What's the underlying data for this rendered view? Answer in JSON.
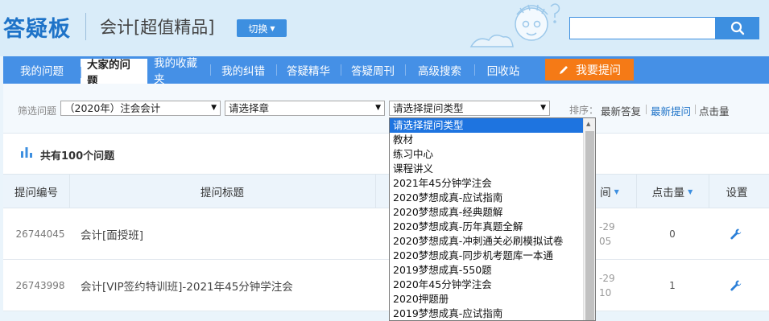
{
  "header": {
    "logo": "答疑板",
    "subtitle": "会计[超值精品]",
    "switch_label": "切换",
    "search_placeholder": ""
  },
  "nav": {
    "items": [
      "我的问题",
      "大家的问题",
      "我的收藏夹",
      "我的纠错",
      "答疑精华",
      "答疑周刊",
      "高级搜索",
      "回收站"
    ],
    "active_index": 1,
    "ask_label": "我要提问"
  },
  "filter": {
    "label": "筛选问题",
    "select1": "（2020年）注会会计",
    "select2": "请选择章",
    "select3": "请选择提问类型",
    "sort_label": "排序：",
    "sort_options": [
      "最新答复",
      "最新提问",
      "点击量"
    ],
    "sort_active_index": 1
  },
  "total": {
    "text": "共有100个问题"
  },
  "table": {
    "headers": {
      "id": "提问编号",
      "title": "提问标题",
      "time_partial": "间",
      "hits": "点击量",
      "settings": "设置"
    },
    "rows": [
      {
        "id": "26744045",
        "title": "会计[面授班]",
        "time_line1": "-29",
        "time_line2": "05",
        "hits": "0"
      },
      {
        "id": "26743998",
        "title": "会计[VIP签约特训班]-2021年45分钟学注会",
        "time_line1": "-29",
        "time_line2": "10",
        "hits": "1"
      }
    ]
  },
  "dropdown": {
    "options": [
      "请选择提问类型",
      "教材",
      "练习中心",
      "课程讲义",
      "2021年45分钟学注会",
      "2020梦想成真-应试指南",
      "2020梦想成真-经典题解",
      "2020梦想成真-历年真题全解",
      "2020梦想成真-冲刺通关必刷模拟试卷",
      "2020梦想成真-同步机考题库一本通",
      "2019梦想成真-550题",
      "2020年45分钟学注会",
      "2020押题册",
      "2019梦想成真-应试指南"
    ],
    "selected_index": 0
  },
  "colors": {
    "brand": "#1e73c8",
    "nav_bg": "#4590e6",
    "ask_button": "#f57a16",
    "dropdown_highlight": "#1e74e0"
  }
}
